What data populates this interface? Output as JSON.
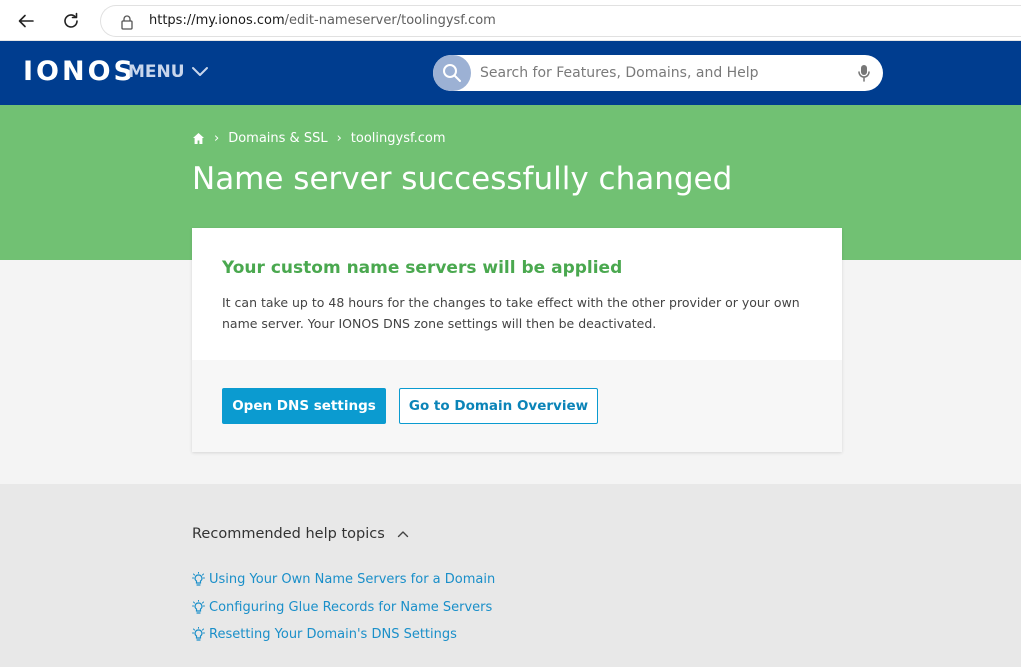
{
  "browser": {
    "url_host": "https://my.ionos.com",
    "url_path": "/edit-nameserver/toolingysf.com"
  },
  "header": {
    "logo": "IONOS",
    "menu_label": "MENU",
    "search_placeholder": "Search for Features, Domains, and Help"
  },
  "breadcrumb": {
    "items": [
      "Domains & SSL",
      "toolingysf.com"
    ]
  },
  "page": {
    "title": "Name server successfully changed"
  },
  "card": {
    "heading": "Your custom name servers will be applied",
    "body": "It can take up to 48 hours for the changes to take effect with the other provider or your own name server. Your IONOS DNS zone settings will then be deactivated.",
    "primary_button": "Open DNS settings",
    "secondary_button": "Go to Domain Overview"
  },
  "help": {
    "title": "Recommended help topics",
    "links": [
      "Using Your Own Name Servers for a Domain",
      "Configuring Glue Records for Name Servers",
      "Resetting Your Domain's DNS Settings"
    ]
  },
  "colors": {
    "brand_header": "#003d8f",
    "hero_green": "#71c173",
    "success_text": "#4aa84f",
    "primary_button": "#0b9bd0",
    "link": "#1a8fc9"
  },
  "icons": [
    "back-arrow-icon",
    "reload-icon",
    "lock-icon",
    "chevron-down-icon",
    "search-icon",
    "microphone-icon",
    "home-icon",
    "chevron-right-icon",
    "chevron-up-icon",
    "lightbulb-icon"
  ]
}
